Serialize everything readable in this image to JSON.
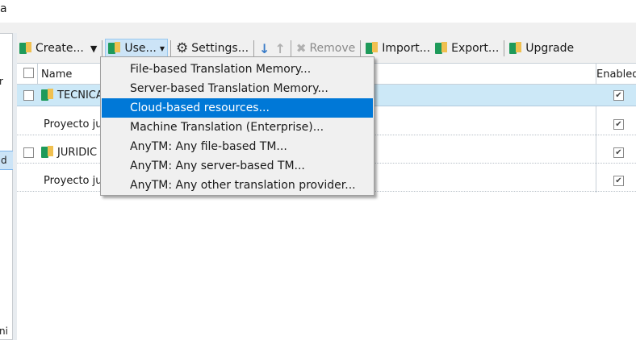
{
  "window": {
    "title_fragment": "a"
  },
  "left_panel": {
    "fragments": [
      "r",
      "d",
      "ni"
    ]
  },
  "toolbar": {
    "create": "Create...",
    "use": "Use...",
    "settings": "Settings...",
    "remove": "Remove",
    "import": "Import...",
    "export": "Export...",
    "upgrade": "Upgrade"
  },
  "table": {
    "columns": {
      "name": "Name",
      "enabled": "Enabled"
    },
    "rows": [
      {
        "name": "TECNICA",
        "enabled": true,
        "selected": true,
        "level": 0
      },
      {
        "name": "Proyecto ju",
        "enabled": true,
        "level": 1
      },
      {
        "name": "JURIDIC",
        "enabled": true,
        "level": 0
      },
      {
        "name": "Proyecto ju",
        "enabled": true,
        "level": 1
      }
    ]
  },
  "use_menu": {
    "items": [
      "File-based Translation Memory...",
      "Server-based Translation Memory...",
      "Cloud-based resources...",
      "Machine Translation (Enterprise)...",
      "AnyTM: Any file-based TM...",
      "AnyTM: Any server-based TM...",
      "AnyTM: Any other translation provider..."
    ],
    "highlighted_index": 2
  },
  "colors": {
    "highlight": "#0078d7",
    "selection": "#cce8f7"
  }
}
